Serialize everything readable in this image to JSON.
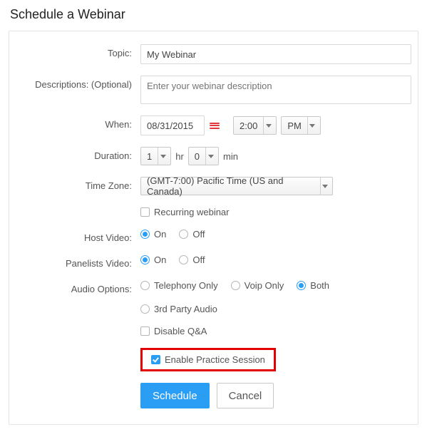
{
  "pageTitle": "Schedule a Webinar",
  "labels": {
    "topic": "Topic:",
    "descriptions": "Descriptions: (Optional)",
    "when": "When:",
    "duration": "Duration:",
    "timezone": "Time Zone:",
    "hostVideo": "Host Video:",
    "panelistsVideo": "Panelists Video:",
    "audioOptions": "Audio Options:"
  },
  "topic": {
    "value": "My Webinar"
  },
  "descriptions": {
    "placeholder": "Enter your webinar description"
  },
  "when": {
    "date": "08/31/2015",
    "time": "2:00",
    "ampm": "PM"
  },
  "duration": {
    "hours": "1",
    "hoursUnit": "hr",
    "minutes": "0",
    "minutesUnit": "min"
  },
  "timezone": {
    "value": "(GMT-7:00) Pacific Time (US and Canada)"
  },
  "recurring": {
    "label": "Recurring webinar",
    "checked": false
  },
  "video": {
    "onLabel": "On",
    "offLabel": "Off",
    "hostSelected": "on",
    "panelistsSelected": "on"
  },
  "audio": {
    "options": {
      "telephony": "Telephony Only",
      "voip": "Voip Only",
      "both": "Both",
      "thirdparty": "3rd Party Audio"
    },
    "selected": "both"
  },
  "disableQA": {
    "label": "Disable Q&A",
    "checked": false
  },
  "practice": {
    "label": "Enable Practice Session",
    "checked": true
  },
  "buttons": {
    "schedule": "Schedule",
    "cancel": "Cancel"
  }
}
